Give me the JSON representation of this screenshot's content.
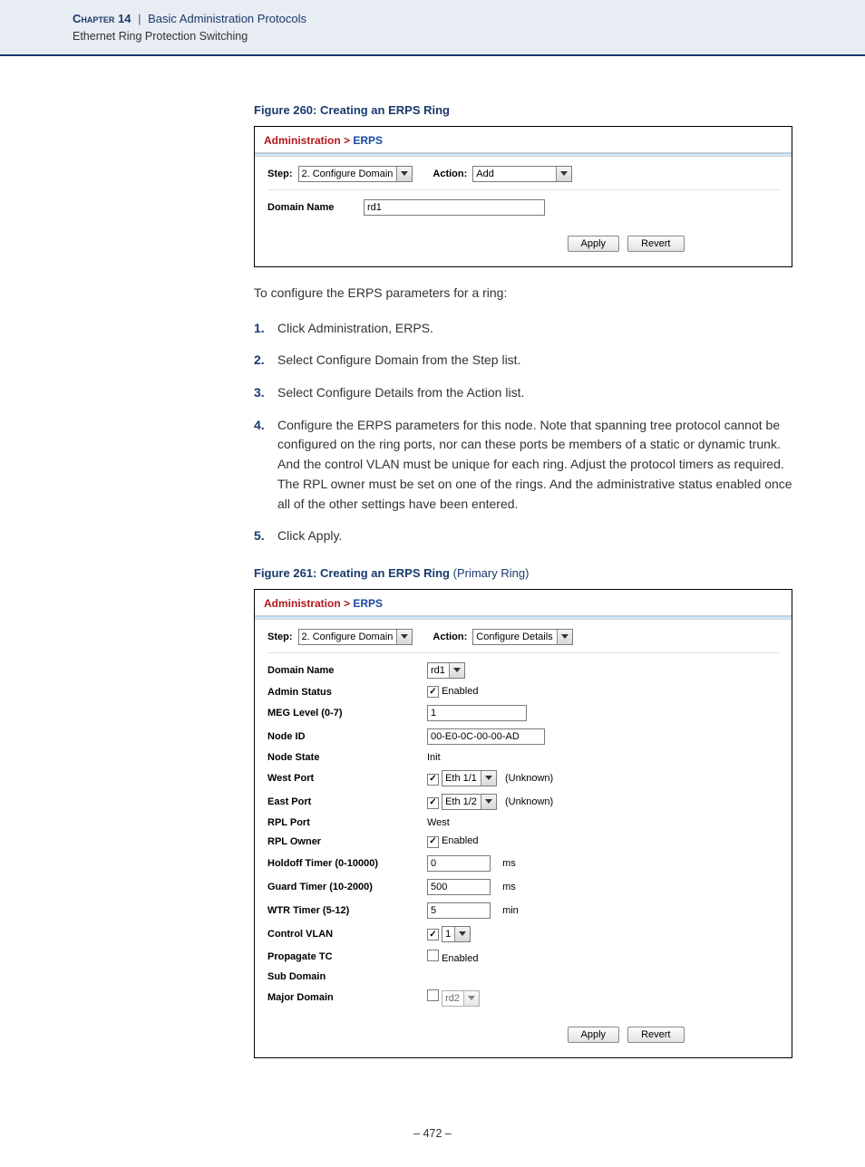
{
  "header": {
    "chapter_label": "Chapter 14",
    "separator": "|",
    "section_title": "Basic Administration Protocols",
    "subsection_title": "Ethernet Ring Protection Switching"
  },
  "figure260": {
    "caption": "Figure 260:  Creating an ERPS Ring",
    "breadcrumb_admin": "Administration",
    "breadcrumb_sep": " > ",
    "breadcrumb_erps": "ERPS",
    "step_label": "Step:",
    "step_value": "2. Configure Domain",
    "action_label": "Action:",
    "action_value": "Add",
    "domain_name_label": "Domain Name",
    "domain_name_value": "rd1",
    "apply_btn": "Apply",
    "revert_btn": "Revert"
  },
  "instructions": {
    "intro": "To configure the ERPS parameters for a ring:",
    "steps": [
      "Click Administration, ERPS.",
      "Select Configure Domain from the Step list.",
      "Select Configure Details from the Action list.",
      "Configure the ERPS parameters for this node. Note that spanning tree protocol cannot be configured on the ring ports, nor can these ports be members of a static or dynamic trunk. And the control VLAN must be unique for each ring. Adjust the protocol timers as required. The RPL owner must be set on one of the rings. And the administrative status enabled once all of the other settings have been entered.",
      "Click Apply."
    ]
  },
  "figure261": {
    "caption_main": "Figure 261:  Creating an ERPS Ring",
    "caption_paren": " (Primary Ring)",
    "breadcrumb_admin": "Administration",
    "breadcrumb_sep": " > ",
    "breadcrumb_erps": "ERPS",
    "step_label": "Step:",
    "step_value": "2. Configure Domain",
    "action_label": "Action:",
    "action_value": "Configure Details",
    "fields": {
      "domain_name": {
        "label": "Domain Name",
        "value": "rd1"
      },
      "admin_status": {
        "label": "Admin Status",
        "checked": true,
        "text": "Enabled"
      },
      "meg_level": {
        "label": "MEG Level (0-7)",
        "value": "1"
      },
      "node_id": {
        "label": "Node ID",
        "value": "00-E0-0C-00-00-AD"
      },
      "node_state": {
        "label": "Node State",
        "value": "Init"
      },
      "west_port": {
        "label": "West Port",
        "checked": true,
        "value": "Eth 1/1",
        "status": "(Unknown)"
      },
      "east_port": {
        "label": "East Port",
        "checked": true,
        "value": "Eth 1/2",
        "status": "(Unknown)"
      },
      "rpl_port": {
        "label": "RPL Port",
        "value": "West"
      },
      "rpl_owner": {
        "label": "RPL Owner",
        "checked": true,
        "text": "Enabled"
      },
      "holdoff": {
        "label": "Holdoff Timer (0-10000)",
        "value": "0",
        "unit": "ms"
      },
      "guard": {
        "label": "Guard Timer (10-2000)",
        "value": "500",
        "unit": "ms"
      },
      "wtr": {
        "label": "WTR Timer (5-12)",
        "value": "5",
        "unit": "min"
      },
      "control_vlan": {
        "label": "Control VLAN",
        "checked": true,
        "value": "1"
      },
      "propagate_tc": {
        "label": "Propagate TC",
        "checked": false,
        "text": "Enabled"
      },
      "sub_domain": {
        "label": "Sub Domain"
      },
      "major_domain": {
        "label": "Major Domain",
        "checked": false,
        "value": "rd2"
      }
    },
    "apply_btn": "Apply",
    "revert_btn": "Revert"
  },
  "footer": {
    "page_number": "–  472  –"
  }
}
